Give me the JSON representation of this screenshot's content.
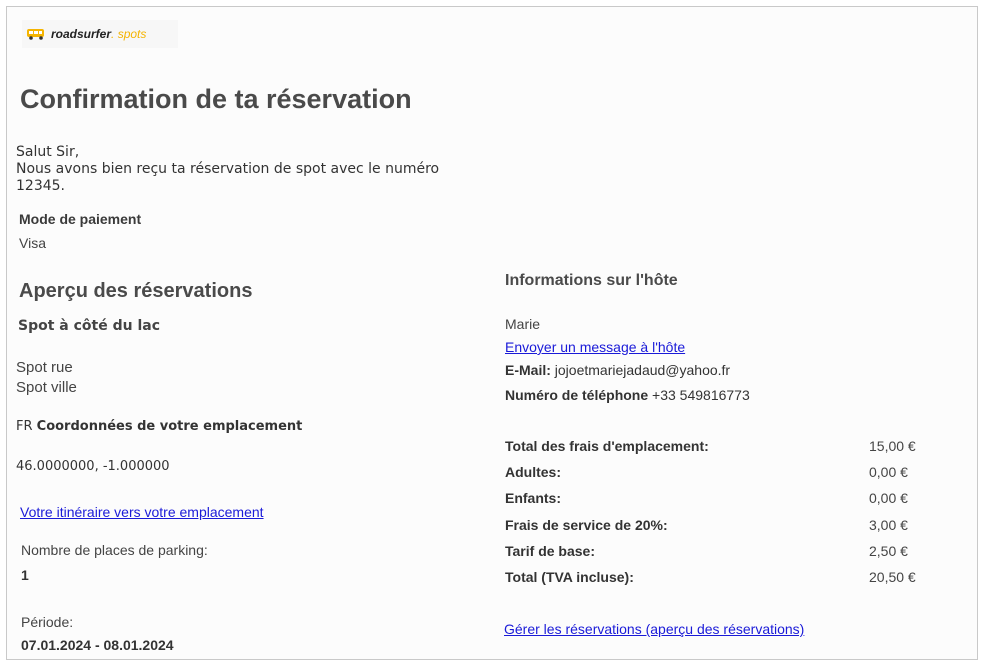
{
  "logo": {
    "text_main": "roadsurfer",
    "text_accent": "spots"
  },
  "title": "Confirmation de ta réservation",
  "greeting": {
    "line1": "Salut Sir,",
    "line2": "Nous avons bien reçu ta réservation de spot avec le numéro 12345."
  },
  "payment": {
    "label": "Mode de paiement",
    "value": "Visa"
  },
  "overview": {
    "title": "Aperçu des réservations",
    "spot_name": "Spot à côté du lac",
    "street": "Spot rue",
    "city": "Spot ville",
    "coords_prefix": "FR",
    "coords_label": "Coordonnées de votre emplacement",
    "coords_value": "46.0000000, -1.000000",
    "route_link": "Votre itinéraire vers votre emplacement",
    "parking_label": "Nombre de places de parking:",
    "parking_value": "1",
    "period_label": "Période:",
    "period_value": "07.01.2024 - 08.01.2024"
  },
  "host": {
    "title": "Informations sur l'hôte",
    "name": "Marie",
    "message_link": "Envoyer un message à l'hôte",
    "email_label": "E-Mail:",
    "email_value": "jojoetmariejadaud@yahoo.fr",
    "phone_label": "Numéro de téléphone",
    "phone_value": "+33 549816773"
  },
  "fees": [
    {
      "label": "Total des frais d'emplacement:",
      "value": "15,00 €"
    },
    {
      "label": "Adultes:",
      "value": "0,00 €"
    },
    {
      "label": "Enfants:",
      "value": "0,00 €"
    },
    {
      "label": "Frais de service de 20%:",
      "value": "3,00 €"
    },
    {
      "label": "Tarif de base:",
      "value": "2,50 €"
    },
    {
      "label": "Total (TVA incluse):",
      "value": "20,50 €"
    }
  ],
  "manage_link": "Gérer les réservations (aperçu des réservations)",
  "colors": {
    "link": "#1a1ad8",
    "logo_accent": "#f5b400",
    "heading": "#4a4a4a"
  }
}
